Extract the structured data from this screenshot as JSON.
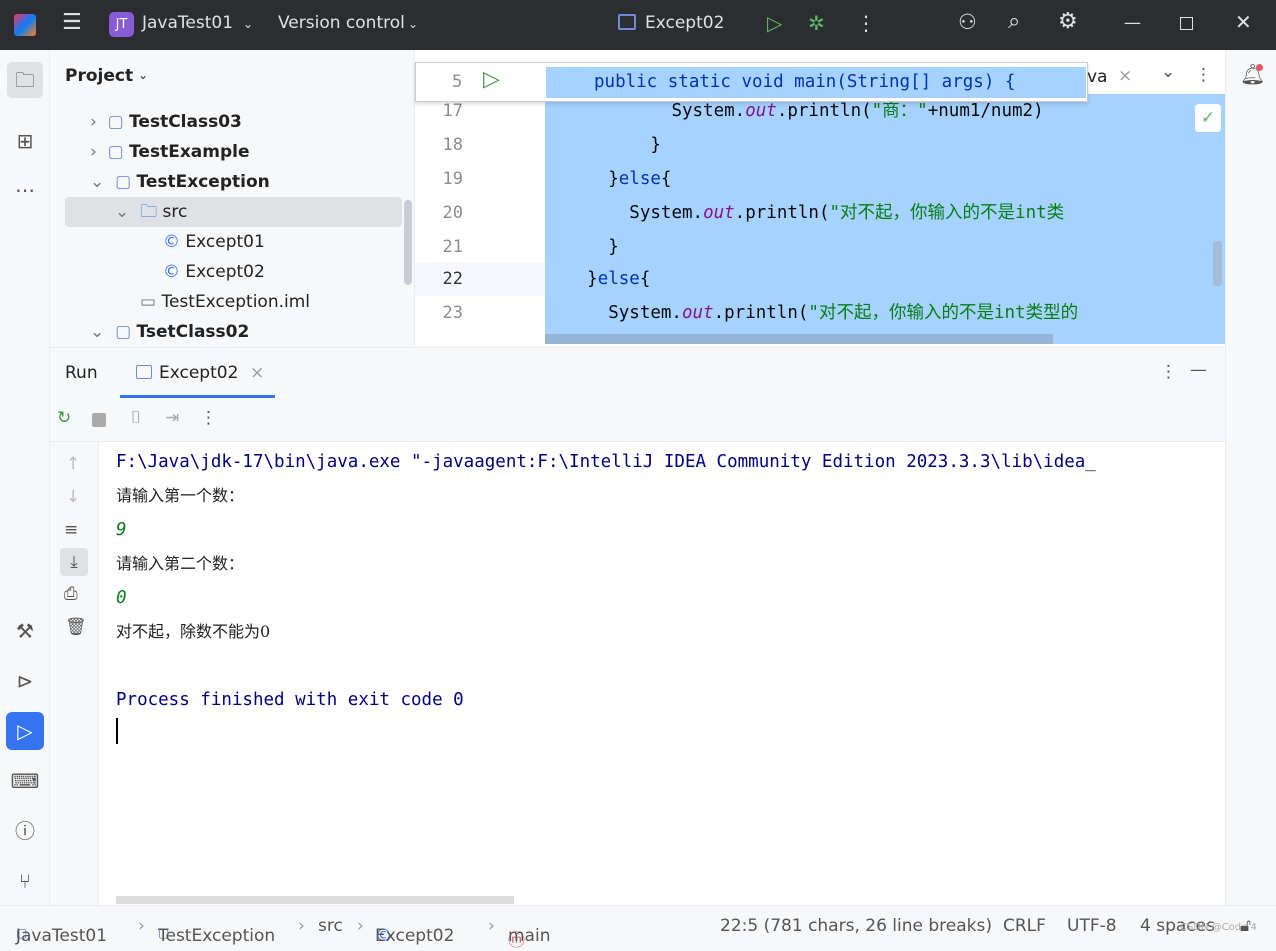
{
  "titlebar": {
    "project_badge": "JT",
    "project_name": "JavaTest01",
    "vcs": "Version control",
    "run_config": "Except02"
  },
  "project_panel": {
    "title": "Project",
    "items": [
      {
        "label": "TestClass03",
        "icon": "module-folder-icon",
        "expanded": false
      },
      {
        "label": "TestExample",
        "icon": "module-folder-icon",
        "expanded": false
      },
      {
        "label": "TestException",
        "icon": "module-folder-icon",
        "expanded": true
      },
      {
        "label": "src",
        "icon": "source-folder-icon",
        "expanded": true,
        "selected": true
      },
      {
        "label": "Except01",
        "icon": "class-icon"
      },
      {
        "label": "Except02",
        "icon": "class-icon"
      },
      {
        "label": "TestException.iml",
        "icon": "iml-file-icon"
      },
      {
        "label": "TsetClass02",
        "icon": "module-folder-icon",
        "expanded": true
      }
    ]
  },
  "editor": {
    "tab_fragment": "va",
    "sticky_line": {
      "num": "5",
      "code": "public static void main(String[] args) {"
    },
    "lines": [
      {
        "num": "17",
        "indent": "            ",
        "pre": "System.",
        "it": "out",
        "post": ".println(",
        "str": "\"商：\"",
        "tail": "+num1/num2)"
      },
      {
        "num": "18",
        "indent": "        ",
        "pre": "}",
        "it": "",
        "post": "",
        "str": "",
        "tail": ""
      },
      {
        "num": "19",
        "indent": "      ",
        "pre": "}",
        "kw": "else",
        "post": "{",
        "str": "",
        "tail": ""
      },
      {
        "num": "20",
        "indent": "          ",
        "pre": "System.",
        "it": "out",
        "post": ".println(",
        "str": "\"对不起，你输入的不是int类",
        "tail": ""
      },
      {
        "num": "21",
        "indent": "      ",
        "pre": "}",
        "it": "",
        "post": "",
        "str": "",
        "tail": ""
      },
      {
        "num": "22",
        "indent": "    ",
        "pre": "}",
        "kw": "else",
        "post": "{",
        "str": "",
        "tail": ""
      },
      {
        "num": "23",
        "indent": "      ",
        "pre": "System.",
        "it": "out",
        "post": ".println(",
        "str": "\"对不起，你输入的不是int类型的",
        "tail": ""
      }
    ],
    "selection_color": "#a6d2ff"
  },
  "run_panel": {
    "title": "Run",
    "tab": "Except02",
    "console": [
      {
        "text": "F:\\Java\\jdk-17\\bin\\java.exe \"-javaagent:F:\\IntelliJ IDEA Community Edition 2023.3.3\\lib\\idea_",
        "kind": "system"
      },
      {
        "text": "请输入第一个数：",
        "kind": "out"
      },
      {
        "text": "9",
        "kind": "input"
      },
      {
        "text": "请输入第二个数：",
        "kind": "out"
      },
      {
        "text": "0",
        "kind": "input"
      },
      {
        "text": "对不起，除数不能为0",
        "kind": "out"
      },
      {
        "text": "",
        "kind": "out"
      },
      {
        "text": "Process finished with exit code 0",
        "kind": "system"
      }
    ]
  },
  "statusbar": {
    "breadcrumb": [
      "JavaTest01",
      "TestException",
      "src",
      "Except02",
      "main"
    ],
    "position": "22:5 (781 chars, 26 line breaks)",
    "line_sep": "CRLF",
    "encoding": "UTF-8",
    "indent": "4 spaces",
    "watermark": "CSDN @Code 4"
  }
}
